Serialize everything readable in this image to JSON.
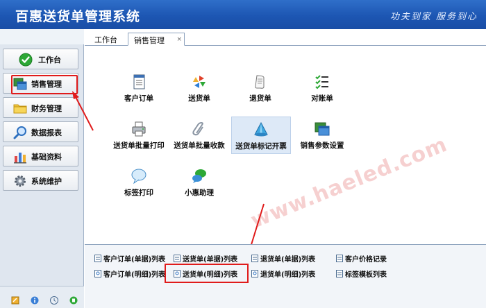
{
  "app": {
    "title": "百惠送货单管理系统",
    "slogan": "功夫到家 服务到心"
  },
  "sidebar": {
    "items": [
      {
        "label": "工作台",
        "icon": "check-icon"
      },
      {
        "label": "销售管理",
        "icon": "windows-icon"
      },
      {
        "label": "财务管理",
        "icon": "folder-icon"
      },
      {
        "label": "数据报表",
        "icon": "magnifier-icon"
      },
      {
        "label": "基础资料",
        "icon": "building-icon"
      },
      {
        "label": "系统维护",
        "icon": "gear-icon"
      }
    ]
  },
  "tabs": [
    {
      "label": "工作台"
    },
    {
      "label": "销售管理",
      "close": "×"
    }
  ],
  "tiles": [
    {
      "label": "客户订单",
      "icon": "document-icon"
    },
    {
      "label": "送货单",
      "icon": "refresh-arrows-icon"
    },
    {
      "label": "退货单",
      "icon": "paper-scroll-icon"
    },
    {
      "label": "对账单",
      "icon": "checklist-icon"
    },
    {
      "label": "送货单批量打印",
      "icon": "printer-icon"
    },
    {
      "label": "送货单批量收款",
      "icon": "paperclip-icon"
    },
    {
      "label": "送货单标记开票",
      "icon": "cone-icon"
    },
    {
      "label": "销售参数设置",
      "icon": "windows-icon"
    },
    {
      "label": "标签打印",
      "icon": "speech-bubble-icon"
    },
    {
      "label": "小惠助理",
      "icon": "chat-people-icon"
    }
  ],
  "links": [
    {
      "label": "客户订单(单据)列表"
    },
    {
      "label": "送货单(单据)列表"
    },
    {
      "label": "退货单(单据)列表"
    },
    {
      "label": "客户价格记录"
    },
    {
      "label": "客户订单(明细)列表"
    },
    {
      "label": "送货单(明细)列表"
    },
    {
      "label": "退货单(明细)列表"
    },
    {
      "label": "标签模板列表"
    }
  ],
  "watermark": "www.haeled.com",
  "colors": {
    "header": "#1d56b3",
    "highlight": "#e01b1b"
  }
}
